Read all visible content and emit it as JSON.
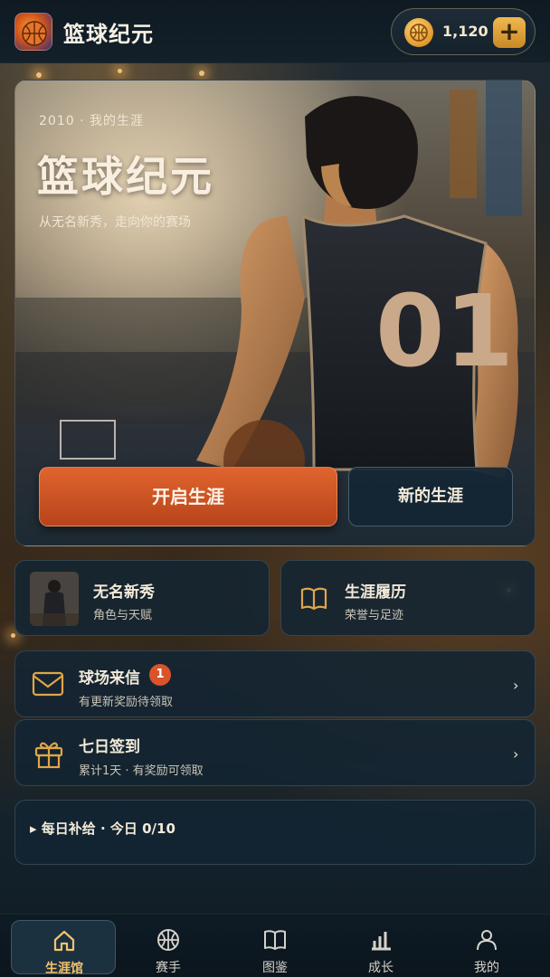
{
  "app": {
    "title": "篮球纪元"
  },
  "currency": {
    "amount": "1,120",
    "add_label": "+"
  },
  "hero": {
    "year_label": "2010 · 我的生涯",
    "title": "篮球纪元",
    "subtitle": "从无名新秀，走向你的赛场",
    "jersey_number": "01",
    "start_button": "开启生涯",
    "new_button": "新的生涯"
  },
  "cards": {
    "rookie": {
      "title": "无名新秀",
      "subtitle": "角色与天赋"
    },
    "history": {
      "title": "生涯履历",
      "subtitle": "荣誉与足迹"
    },
    "mail": {
      "title": "球场来信",
      "badge": "1",
      "subtitle": "有更新奖励待领取"
    },
    "checkin": {
      "title": "七日签到",
      "subtitle": "累计1天 · 有奖励可领取"
    },
    "supply": {
      "title": "▸ 每日补给 · 今日 0/10"
    }
  },
  "nav": {
    "items": [
      {
        "label": "生涯馆",
        "icon": "home-icon",
        "active": true
      },
      {
        "label": "赛手",
        "icon": "basketball-icon",
        "active": false
      },
      {
        "label": "图鉴",
        "icon": "book-icon",
        "active": false
      },
      {
        "label": "成长",
        "icon": "chart-icon",
        "active": false
      },
      {
        "label": "我的",
        "icon": "user-icon",
        "active": false
      }
    ]
  },
  "colors": {
    "accent": "#e0642e",
    "gold": "#f0b750",
    "panel": "#122432"
  }
}
